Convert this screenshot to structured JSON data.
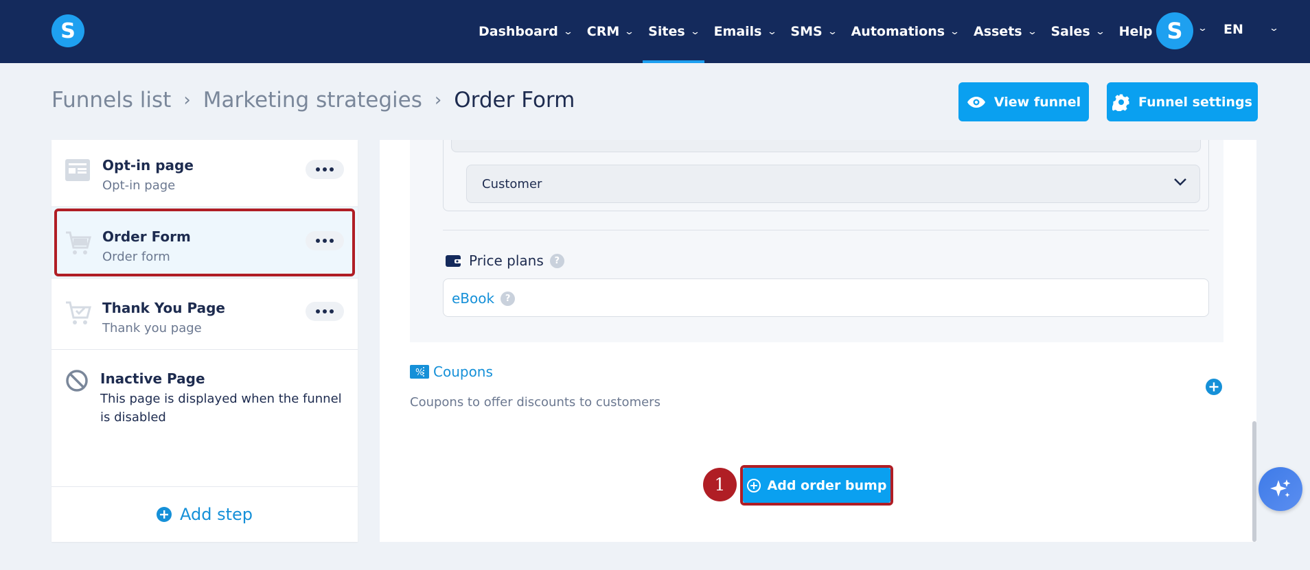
{
  "app": {
    "logo_letter": "S",
    "avatar_letter": "S"
  },
  "nav": {
    "items": [
      {
        "label": "Dashboard",
        "has_menu": true
      },
      {
        "label": "CRM",
        "has_menu": true
      },
      {
        "label": "Sites",
        "has_menu": true,
        "active": true
      },
      {
        "label": "Emails",
        "has_menu": true
      },
      {
        "label": "SMS",
        "has_menu": true
      },
      {
        "label": "Automations",
        "has_menu": true
      },
      {
        "label": "Assets",
        "has_menu": true
      },
      {
        "label": "Sales",
        "has_menu": true
      },
      {
        "label": "Help",
        "has_menu": false
      }
    ],
    "bell_icon": "bell-icon",
    "language": "EN"
  },
  "breadcrumb": {
    "items": [
      "Funnels list",
      "Marketing strategies",
      "Order Form"
    ]
  },
  "header_buttons": {
    "view_funnel": "View funnel",
    "funnel_settings": "Funnel settings"
  },
  "steps": [
    {
      "title": "Opt-in page",
      "subtitle": "Opt-in page",
      "icon": "page-form-icon"
    },
    {
      "title": "Order Form",
      "subtitle": "Order form",
      "icon": "cart-icon",
      "selected": true
    },
    {
      "title": "Thank You Page",
      "subtitle": "Thank you page",
      "icon": "cart-check-icon"
    }
  ],
  "inactive_step": {
    "title": "Inactive Page",
    "description": "This page is displayed when the funnel is disabled",
    "icon": "ban-icon"
  },
  "add_step_label": "Add step",
  "form": {
    "customer_select_value": "Customer",
    "price_plans_label": "Price plans",
    "price_plan_value": "eBook",
    "coupons_label": "Coupons",
    "coupons_description": "Coupons to offer discounts to customers",
    "help_glyph": "?"
  },
  "add_order_bump_label": "Add order bump",
  "annotation_number": "1",
  "colors": {
    "topbar": "#142a5c",
    "accent": "#0aa0f0",
    "highlight": "#b01e25"
  }
}
